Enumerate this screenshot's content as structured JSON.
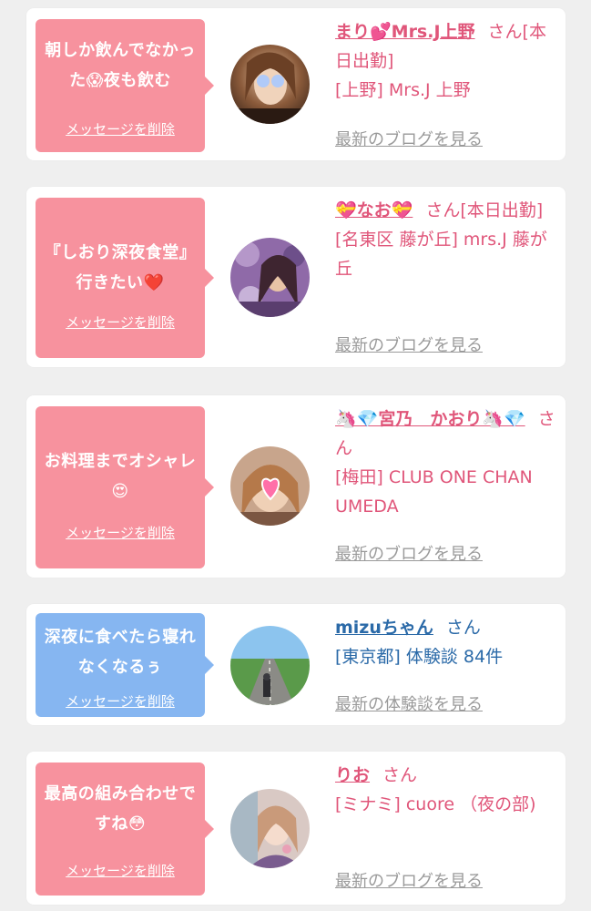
{
  "cards": [
    {
      "message": "朝しか飲んでなかった😱夜も飲む",
      "delete_label": "メッセージを削除",
      "name": "まり💕Mrs.J上野",
      "san": "さん[本日出勤]",
      "shop": "[上野] Mrs.J 上野",
      "blog_link": "最新のブログを見る",
      "theme": "#f7929e"
    },
    {
      "message": "『しおり深夜食堂』行きたい❤️",
      "delete_label": "メッセージを削除",
      "name": "💝なお💝",
      "san": "さん[本日出勤]",
      "shop": "[名東区 藤が丘] mrs.J 藤が丘",
      "blog_link": "最新のブログを見る",
      "theme": "#f7929e"
    },
    {
      "message": "お料理までオシャレ😍",
      "delete_label": "メッセージを削除",
      "name": "🦄💎宮乃　かおり🦄💎",
      "san": "さん",
      "shop": "[梅田] CLUB ONE CHAN UMEDA",
      "blog_link": "最新のブログを見る",
      "theme": "#f7929e"
    },
    {
      "message": "深夜に食べたら寝れなくなるぅ",
      "delete_label": "メッセージを削除",
      "name": "mizuちゃん",
      "san": "さん",
      "shop": "[東京都] 体験談 84件",
      "blog_link": "最新の体験談を見る",
      "theme": "#86b6f1"
    },
    {
      "message": "最高の組み合わせですね😳",
      "delete_label": "メッセージを削除",
      "name": "りお",
      "san": "さん",
      "shop": "[ミナミ] cuore （夜の部)",
      "blog_link": "最新のブログを見る",
      "theme": "#f7929e"
    }
  ]
}
